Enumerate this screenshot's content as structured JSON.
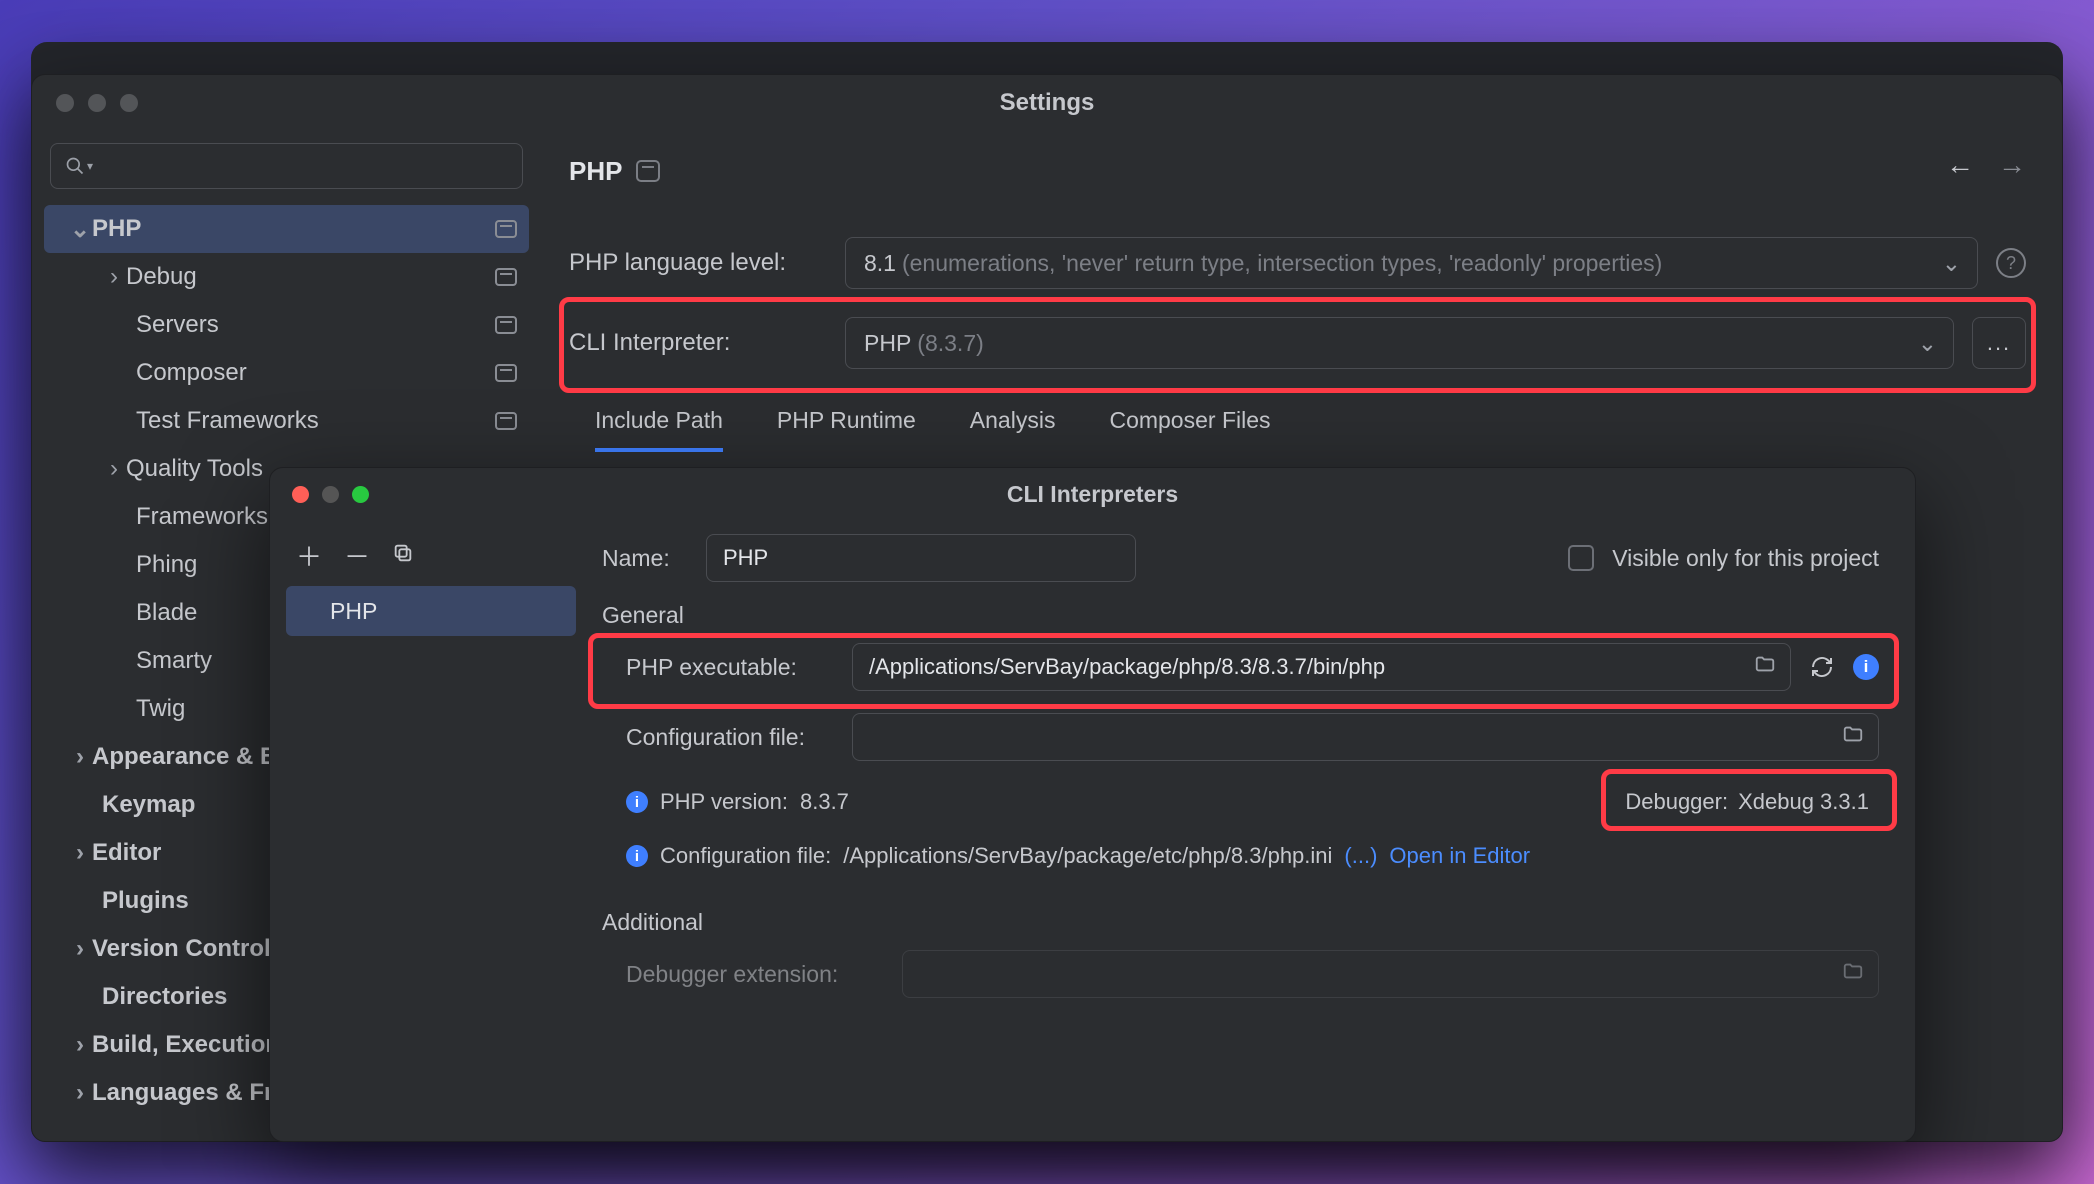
{
  "settings": {
    "title": "Settings",
    "search_placeholder": "",
    "tree": {
      "php": "PHP",
      "debug": "Debug",
      "servers": "Servers",
      "composer": "Composer",
      "test_frameworks": "Test Frameworks",
      "quality_tools": "Quality Tools",
      "frameworks": "Frameworks",
      "phing": "Phing",
      "blade": "Blade",
      "smarty": "Smarty",
      "twig": "Twig",
      "appearance": "Appearance & Behavior",
      "keymap": "Keymap",
      "editor": "Editor",
      "plugins": "Plugins",
      "version_control": "Version Control",
      "directories": "Directories",
      "build": "Build, Execution, Deployment",
      "languages": "Languages & Frameworks"
    },
    "page": {
      "crumb": "PHP",
      "lang_level_label": "PHP language level:",
      "lang_level_value": "8.1",
      "lang_level_hint": "(enumerations, 'never' return type, intersection types, 'readonly' properties)",
      "cli_label": "CLI Interpreter:",
      "cli_value": "PHP",
      "cli_hint": "(8.3.7)",
      "more": "...",
      "tabs": {
        "include_path": "Include Path",
        "php_runtime": "PHP Runtime",
        "analysis": "Analysis",
        "composer_files": "Composer Files"
      }
    }
  },
  "cli": {
    "title": "CLI Interpreters",
    "list_item": "PHP",
    "name_label": "Name:",
    "name_value": "PHP",
    "visible_only": "Visible only for this project",
    "general": "General",
    "php_exec_label": "PHP executable:",
    "php_exec_value": "/Applications/ServBay/package/php/8.3/8.3.7/bin/php",
    "config_file_label": "Configuration file:",
    "config_file_value": "",
    "php_version_label": "PHP version:",
    "php_version_value": "8.3.7",
    "debugger_label": "Debugger:",
    "debugger_value": "Xdebug 3.3.1",
    "config_info_label": "Configuration file:",
    "config_info_value": "/Applications/ServBay/package/etc/php/8.3/php.ini",
    "ellipsis": "(...)",
    "open_in_editor": "Open in Editor",
    "additional": "Additional",
    "debugger_ext_label": "Debugger extension:"
  }
}
